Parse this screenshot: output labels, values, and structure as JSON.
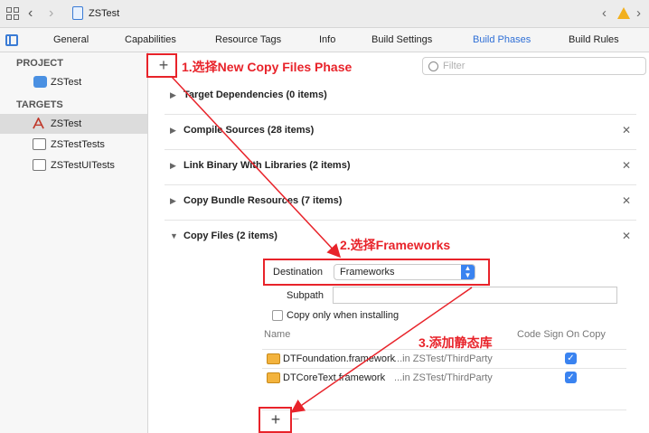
{
  "toolbar": {
    "back_icon": "chevron-left-icon",
    "forward_icon": "chevron-right-icon",
    "project_title": "ZSTest"
  },
  "tabs": [
    {
      "label": "General",
      "active": false
    },
    {
      "label": "Capabilities",
      "active": false
    },
    {
      "label": "Resource Tags",
      "active": false
    },
    {
      "label": "Info",
      "active": false
    },
    {
      "label": "Build Settings",
      "active": false
    },
    {
      "label": "Build Phases",
      "active": true
    },
    {
      "label": "Build Rules",
      "active": false
    }
  ],
  "sidebar": {
    "project_header": "PROJECT",
    "project_item": "ZSTest",
    "targets_header": "TARGETS",
    "targets": [
      {
        "label": "ZSTest",
        "selected": true
      },
      {
        "label": "ZSTestTests",
        "selected": false
      },
      {
        "label": "ZSTestUITests",
        "selected": false
      }
    ]
  },
  "filter": {
    "placeholder": "Filter"
  },
  "phases": [
    {
      "title": "Target Dependencies (0 items)",
      "closable": false
    },
    {
      "title": "Compile Sources (28 items)",
      "closable": true
    },
    {
      "title": "Link Binary With Libraries (2 items)",
      "closable": true
    },
    {
      "title": "Copy Bundle Resources (7 items)",
      "closable": true
    },
    {
      "title": "Copy Files (2 items)",
      "closable": true,
      "expanded": true
    }
  ],
  "copy_files": {
    "destination_label": "Destination",
    "destination_value": "Frameworks",
    "subpath_label": "Subpath",
    "subpath_value": "",
    "copy_only_label": "Copy only when installing",
    "col_name": "Name",
    "col_codesign": "Code Sign On Copy",
    "files": [
      {
        "name": "DTFoundation.framework",
        "path": "...in ZSTest/ThirdParty",
        "code_sign": true
      },
      {
        "name": "DTCoreText.framework",
        "path": "...in ZSTest/ThirdParty",
        "code_sign": true
      }
    ],
    "add_symbol": "+",
    "remove_symbol": "−"
  },
  "annotations": {
    "step1": "1.选择New Copy Files Phase",
    "step2": "2.选择Frameworks",
    "step3": "3.添加静态库"
  },
  "colors": {
    "accent": "#2f6fd6",
    "annotation_red": "#e8232a",
    "warning": "#f2b01e"
  }
}
